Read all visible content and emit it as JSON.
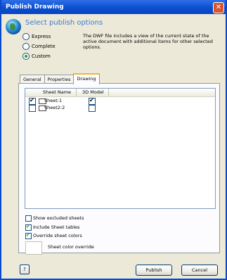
{
  "window": {
    "title": "Publish Drawing"
  },
  "header": {
    "title": "Select publish options"
  },
  "options": {
    "express": "Express",
    "complete": "Complete",
    "custom": "Custom",
    "selected": "custom",
    "description": "The DWF file includes a view of the current state of the active document with additional items for other selected options."
  },
  "tabs": [
    {
      "label": "General",
      "active": false
    },
    {
      "label": "Properties",
      "active": false
    },
    {
      "label": "Drawing",
      "active": true
    }
  ],
  "sheet_list": {
    "columns": {
      "name": "Sheet Name",
      "model": "3D Model"
    },
    "rows": [
      {
        "name": "Sheet:1",
        "publish": true,
        "model": true
      },
      {
        "name": "Sheet2:2",
        "publish": false,
        "model": false
      }
    ]
  },
  "checkboxes": {
    "show_excluded": {
      "label": "Show excluded sheets",
      "checked": false
    },
    "include_tables": {
      "label": "Include Sheet tables",
      "checked": true
    },
    "override_colors": {
      "label": "Override sheet colors",
      "checked": true
    }
  },
  "color_override": {
    "label": "Sheet color override"
  },
  "buttons": {
    "publish": "Publish",
    "cancel": "Cancel"
  },
  "icons": [
    "globe-icon",
    "close-icon",
    "help-icon",
    "sheet-icon"
  ]
}
